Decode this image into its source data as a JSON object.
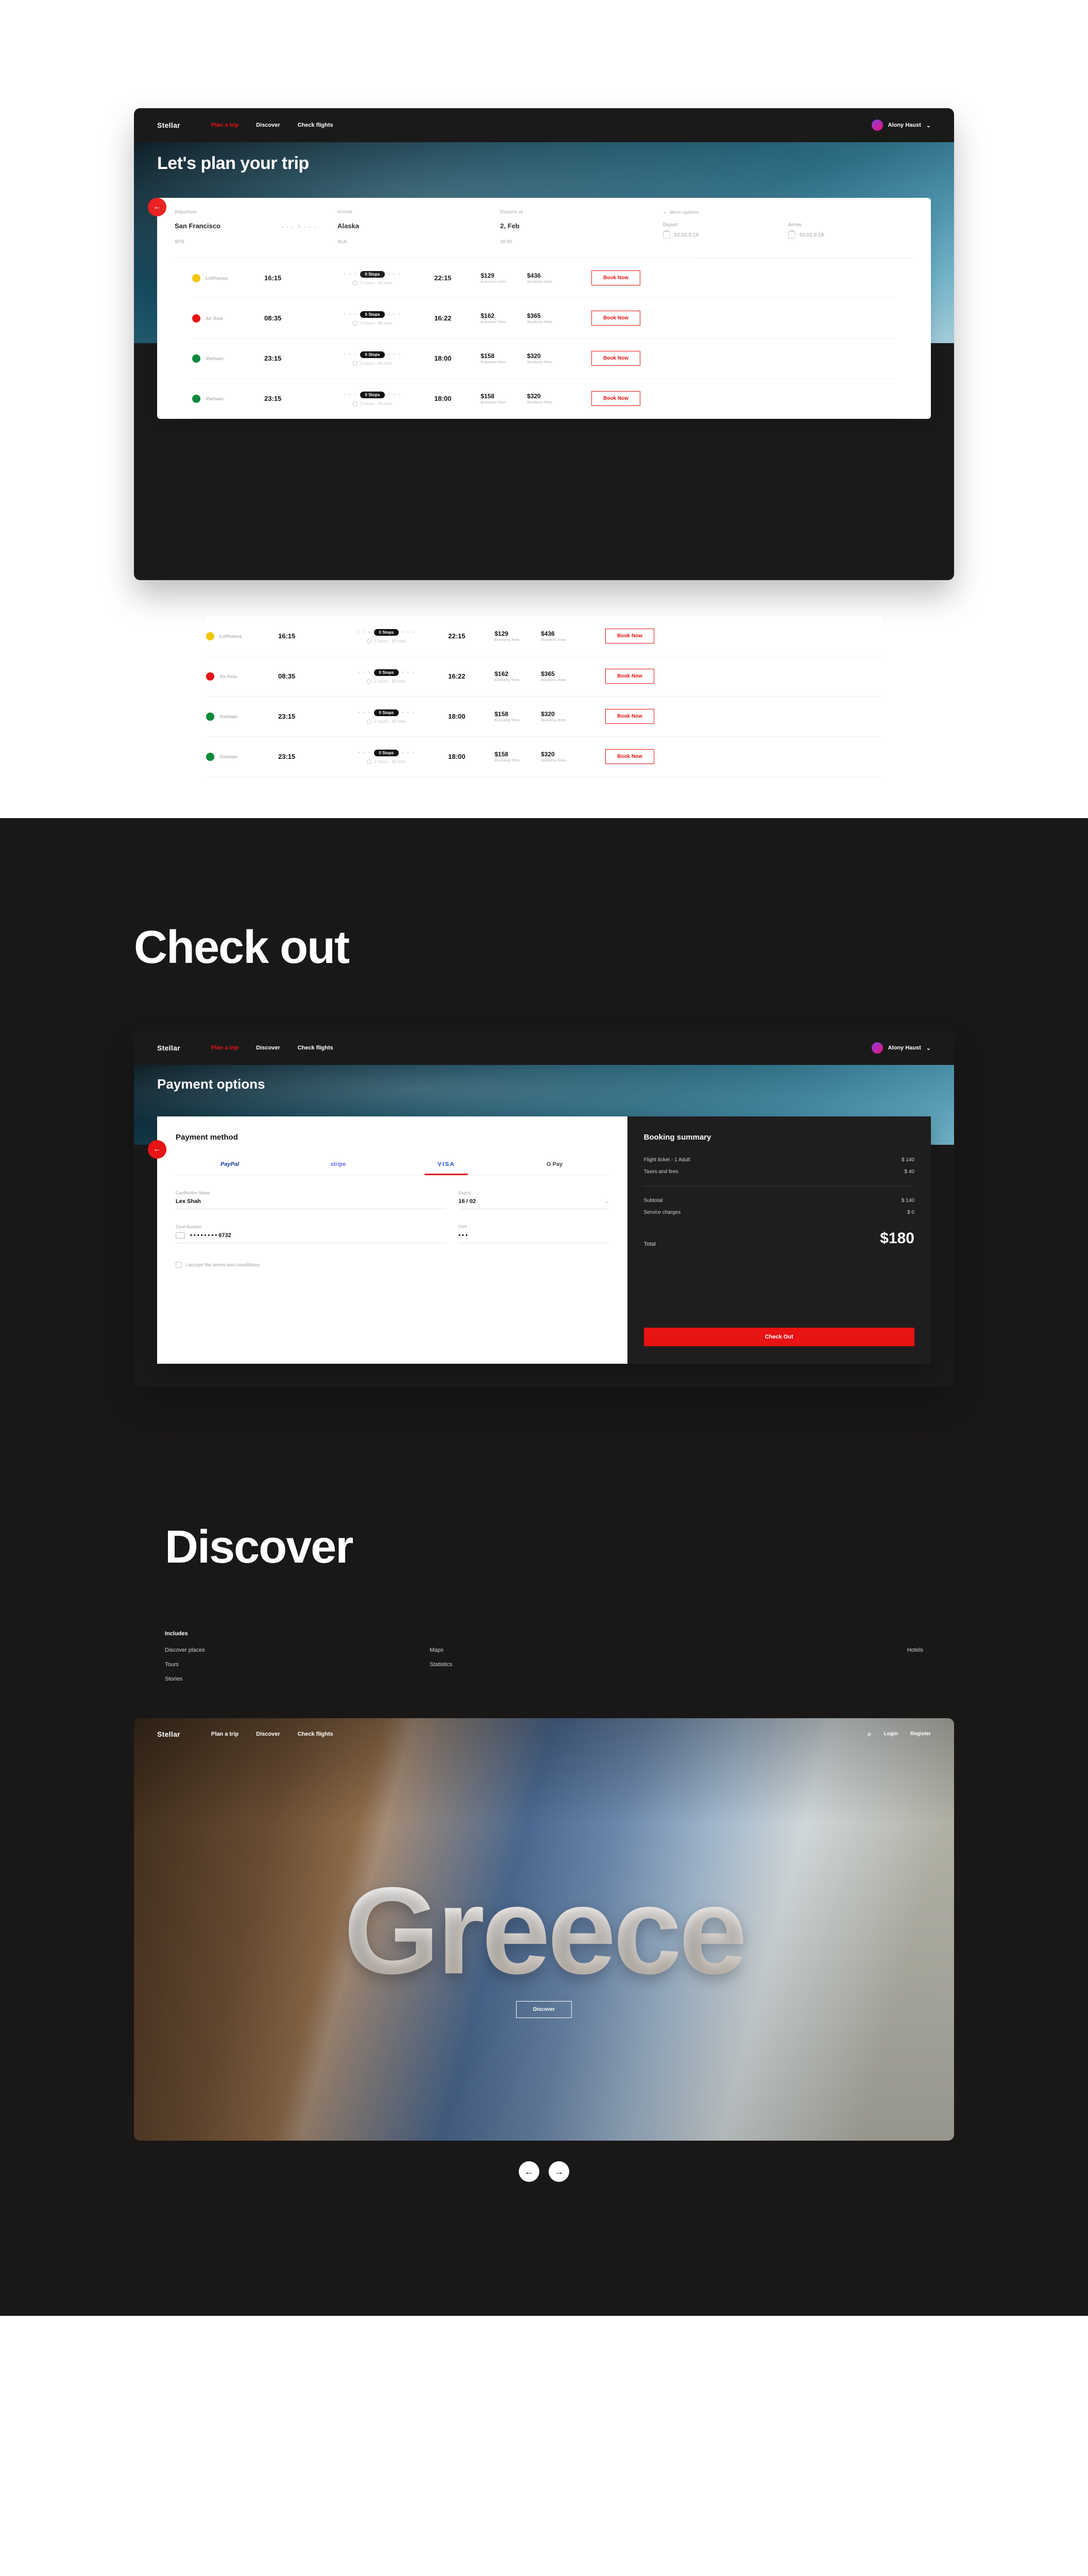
{
  "brand": "Stellar",
  "nav": {
    "plan": "Plan a trip",
    "discover": "Discover",
    "flights": "Check flights"
  },
  "user": {
    "name": "Alony Haust"
  },
  "search": {
    "title": "Let's plan your trip",
    "labels": {
      "departure": "Departure",
      "arrival": "Arrival",
      "departs": "Departs at",
      "more": "More options",
      "depart": "Depart",
      "arrive": "Arrive"
    },
    "from": {
      "city": "San Francisco",
      "code": "SFO"
    },
    "to": {
      "city": "Alaska",
      "code": "ALK"
    },
    "date": "2, Feb",
    "time": "18:00",
    "depart_dt": "02.02.0.19",
    "arrive_dt": "02.02.0.19"
  },
  "flight_labels": {
    "economy": "Economy from",
    "business": "Business from",
    "book": "Book Now",
    "duration_meta": "2 hours · 48 mins"
  },
  "flights_a": [
    {
      "airline": "Lufthansa",
      "color": "#f2c400",
      "dep": "16:15",
      "arr": "22:15",
      "stops": "0 Stops",
      "eco": "$129",
      "bus": "$436"
    },
    {
      "airline": "Air Asia",
      "color": "#e81313",
      "dep": "08:35",
      "arr": "16:22",
      "stops": "0 Stops",
      "eco": "$162",
      "bus": "$365"
    },
    {
      "airline": "Vietnam",
      "color": "#0a8a3a",
      "dep": "23:15",
      "arr": "18:00",
      "stops": "0 Stops",
      "eco": "$158",
      "bus": "$320"
    },
    {
      "airline": "Vietnam",
      "color": "#0a8a3a",
      "dep": "23:15",
      "arr": "18:00",
      "stops": "0 Stops",
      "eco": "$158",
      "bus": "$320"
    }
  ],
  "flights_b": [
    {
      "airline": "Lufthansa",
      "color": "#f2c400",
      "dep": "16:15",
      "arr": "22:15",
      "stops": "0 Stops",
      "eco": "$129",
      "bus": "$436"
    },
    {
      "airline": "Air Asia",
      "color": "#e81313",
      "dep": "08:35",
      "arr": "16:22",
      "stops": "0 Stops",
      "eco": "$162",
      "bus": "$365"
    },
    {
      "airline": "Vietnam",
      "color": "#0a8a3a",
      "dep": "23:15",
      "arr": "18:00",
      "stops": "0 Stops",
      "eco": "$158",
      "bus": "$320"
    },
    {
      "airline": "Vietnam",
      "color": "#0a8a3a",
      "dep": "23:15",
      "arr": "18:00",
      "stops": "0 Stops",
      "eco": "$158",
      "bus": "$320"
    }
  ],
  "checkout": {
    "section_label": "Check out",
    "title": "Payment options",
    "pm_title": "Payment method",
    "tabs": {
      "paypal": "PayPal",
      "stripe": "stripe",
      "visa": "VISA",
      "gpay": "G Pay"
    },
    "fields": {
      "name_label": "Cardholder Name",
      "name": "Lex Shah",
      "expiry_label": "Expiry",
      "expiry": "16 / 02",
      "card_label": "Card Number",
      "card": "• • • •    • • • •    6732",
      "cvv_label": "CVV",
      "cvv": "• • •"
    },
    "terms": "I accept the terms and conditions",
    "summary": {
      "title": "Booking summary",
      "r1": {
        "l": "Flight ticket - 1 Adult",
        "v": "$ 140"
      },
      "r2": {
        "l": "Taxes and fees",
        "v": "$ 40"
      },
      "r3": {
        "l": "Subtotal",
        "v": "$ 140"
      },
      "r4": {
        "l": "Service charges",
        "v": "$ 0"
      },
      "total_l": "Total",
      "total_v": "$180",
      "cta": "Check Out"
    }
  },
  "discoverPage": {
    "section_label": "Discover",
    "includes": "Includes",
    "features": {
      "a": "Discover places",
      "b": "Maps",
      "c": "Hotels",
      "d": "Tours",
      "e": "Statistics",
      "f": "Stories"
    },
    "auth": {
      "login": "Login",
      "register": "Register"
    },
    "headline": "Greece",
    "cta": "Discover"
  }
}
